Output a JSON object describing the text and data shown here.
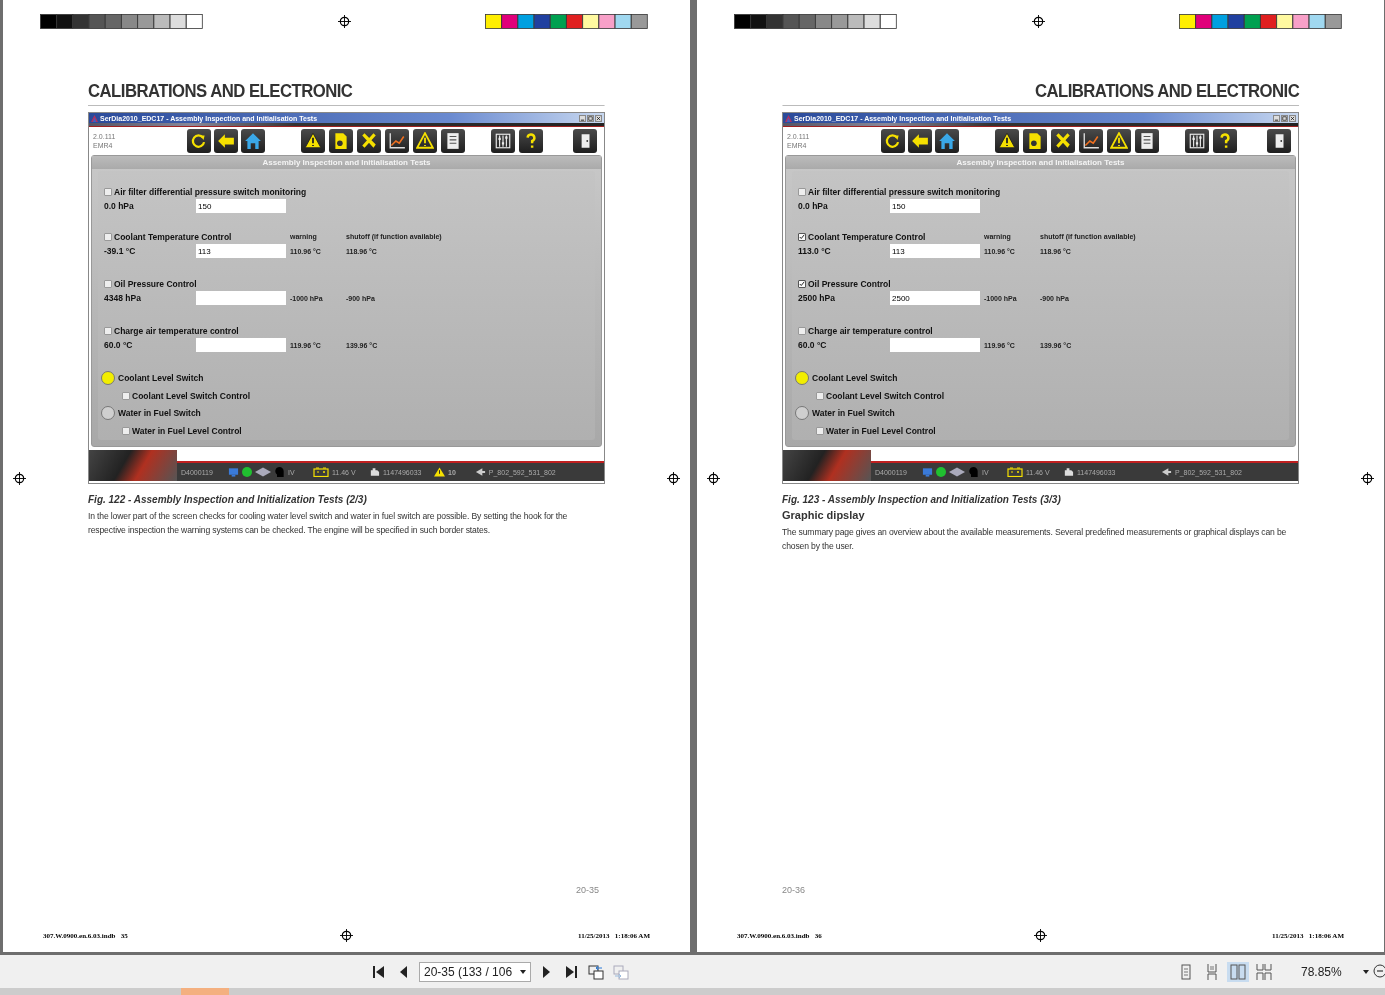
{
  "pages": [
    {
      "heading": "CALIBRATIONS AND ELECTRONIC",
      "app": {
        "title": "SerDia2010_EDC17 - Assembly Inspection and Initialisation Tests",
        "version": "2.0.111",
        "ecu": "EMR4",
        "panel_title": "Assembly Inspection and Initialisation Tests",
        "tests": [
          {
            "label": "Air filter differential pressure switch monitoring",
            "checked": false,
            "reading": "0.0 hPa",
            "value": "150"
          },
          {
            "label": "Coolant Temperature Control",
            "checked": false,
            "reading": "-39.1 °C",
            "value": "113",
            "warning_header": "warning",
            "shutoff_header": "shutoff (if function available)",
            "warning": "110.96 °C",
            "shutoff": "118.96 °C"
          },
          {
            "label": "Oil Pressure Control",
            "checked": false,
            "reading": "4348 hPa",
            "warning": "-1000 hPa",
            "shutoff": "-900 hPa"
          },
          {
            "label": "Charge air temperature control",
            "checked": false,
            "reading": "60.0 °C",
            "warning": "119.96 °C",
            "shutoff": "139.96 °C"
          }
        ],
        "switches": [
          {
            "label": "Coolant Level Switch",
            "color": "#f2ee00",
            "control": {
              "label": "Coolant Level Switch Control",
              "checked": false
            }
          },
          {
            "label": "Water in Fuel Switch",
            "color": "#cfcfcf",
            "control": {
              "label": "Water in Fuel Level Control",
              "checked": false
            }
          }
        ],
        "status": {
          "ecu_id": "D4000119",
          "gear": "IV",
          "voltage": "11.46 V",
          "serial": "1147496033",
          "warning_count": "10",
          "program": "P_802_592_531_802"
        }
      },
      "caption": "Fig. 122 - Assembly Inspection and Initialization Tests (2/3)",
      "body": "In the lower part of the screen checks for cooling water level switch and water in fuel switch are possible. By setting the hook for the respective inspection the warning systems can be checked. The engine will be specified in such border states.",
      "page_number": "20-35",
      "slug": "307.W.0900.en.6.03.indb   35",
      "timestamp": "11/25/2013   1:18:06 AM"
    },
    {
      "heading": "CALIBRATIONS AND ELECTRONIC",
      "app": {
        "title": "SerDia2010_EDC17 - Assembly Inspection and Initialisation Tests",
        "version": "2.0.111",
        "ecu": "EMR4",
        "panel_title": "Assembly Inspection and Initialisation Tests",
        "tests": [
          {
            "label": "Air filter differential pressure switch monitoring",
            "checked": false,
            "reading": "0.0 hPa",
            "value": "150"
          },
          {
            "label": "Coolant Temperature Control",
            "checked": true,
            "reading": "113.0 °C",
            "value": "113",
            "warning_header": "warning",
            "shutoff_header": "shutoff (if function available)",
            "warning": "110.96 °C",
            "shutoff": "118.96 °C"
          },
          {
            "label": "Oil Pressure Control",
            "checked": true,
            "reading": "2500 hPa",
            "value": "2500",
            "warning": "-1000 hPa",
            "shutoff": "-900 hPa"
          },
          {
            "label": "Charge air temperature control",
            "checked": false,
            "reading": "60.0 °C",
            "warning": "119.96 °C",
            "shutoff": "139.96 °C"
          }
        ],
        "switches": [
          {
            "label": "Coolant Level Switch",
            "color": "#f2ee00",
            "control": {
              "label": "Coolant Level Switch Control",
              "checked": false
            }
          },
          {
            "label": "Water in Fuel Switch",
            "color": "#cfcfcf",
            "control": {
              "label": "Water in Fuel Level Control",
              "checked": false
            }
          }
        ],
        "status": {
          "ecu_id": "D4000119",
          "gear": "IV",
          "voltage": "11.46 V",
          "serial": "1147496033",
          "program": "P_802_592_531_802"
        }
      },
      "caption": "Fig. 123 - Assembly Inspection and Initialization Tests (3/3)",
      "subheading": "Graphic dipslay",
      "body": "The summary page gives an overview about the available measurements. Several predefined measurements or graphical displays can be chosen by the user.",
      "page_number": "20-36",
      "slug": "307.W.0900.en.6.03.indb   36",
      "timestamp": "11/25/2013   1:18:06 AM"
    }
  ],
  "viewer_toolbar": {
    "page_field": "20-35 (133 / 106",
    "view_modes": [
      {
        "kind": "single",
        "selected": false
      },
      {
        "kind": "continuous",
        "selected": false
      },
      {
        "kind": "two-page",
        "selected": true
      },
      {
        "kind": "two-page-continuous",
        "selected": false
      }
    ],
    "zoom": "78.85%"
  }
}
